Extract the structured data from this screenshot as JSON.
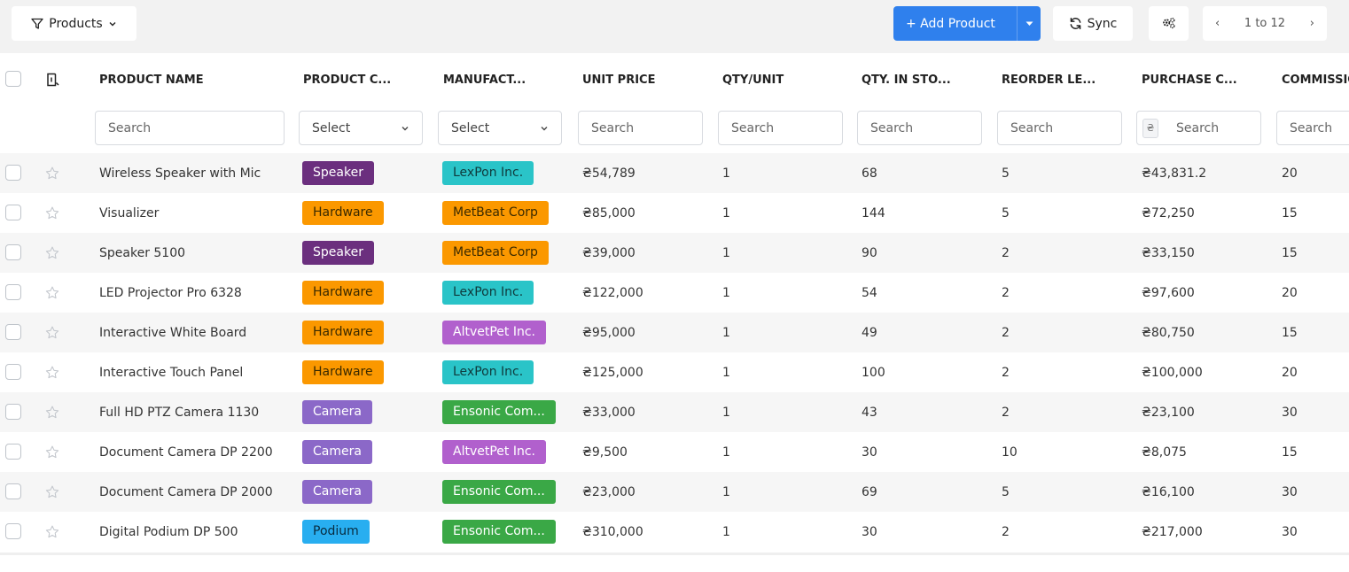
{
  "toolbar": {
    "products_label": "Products",
    "add_label": "+ Add Product",
    "sync_label": "Sync",
    "pager_label": "1 to 12"
  },
  "columns": [
    "PRODUCT NAME",
    "PRODUCT C...",
    "MANUFACT...",
    "UNIT PRICE",
    "QTY/UNIT",
    "QTY. IN STO...",
    "REORDER LE...",
    "PURCHASE C...",
    "COMMISSION"
  ],
  "filters": {
    "name": "Search",
    "category": "Select",
    "manufacturer": "Select",
    "unit_price": "Search",
    "qty_unit": "Search",
    "qty_stock": "Search",
    "reorder": "Search",
    "purchase_currency": "₴",
    "purchase": "Search",
    "commission": "Search"
  },
  "colors": {
    "accent": "#2f80ed",
    "Speaker": "#6b2f7e",
    "Hardware": "#fb9800",
    "Camera": "#8b68c8",
    "Podium": "#28aef0",
    "LexPon Inc.": "#2ac4c8",
    "MetBeat Corp": "#fb9800",
    "AltvetPet Inc.": "#b160cd",
    "Ensonic Com...": "#3aa846"
  },
  "rows": [
    {
      "name": "Wireless Speaker with Mic",
      "category": "Speaker",
      "manufacturer": "LexPon Inc.",
      "unit_price": "₴54,789",
      "qty_unit": "1",
      "qty_stock": "68",
      "reorder": "5",
      "purchase": "₴43,831.2",
      "commission": "20"
    },
    {
      "name": "Visualizer",
      "category": "Hardware",
      "manufacturer": "MetBeat Corp",
      "unit_price": "₴85,000",
      "qty_unit": "1",
      "qty_stock": "144",
      "reorder": "5",
      "purchase": "₴72,250",
      "commission": "15"
    },
    {
      "name": "Speaker 5100",
      "category": "Speaker",
      "manufacturer": "MetBeat Corp",
      "unit_price": "₴39,000",
      "qty_unit": "1",
      "qty_stock": "90",
      "reorder": "2",
      "purchase": "₴33,150",
      "commission": "15"
    },
    {
      "name": "LED Projector Pro 6328",
      "category": "Hardware",
      "manufacturer": "LexPon Inc.",
      "unit_price": "₴122,000",
      "qty_unit": "1",
      "qty_stock": "54",
      "reorder": "2",
      "purchase": "₴97,600",
      "commission": "20"
    },
    {
      "name": "Interactive White Board",
      "category": "Hardware",
      "manufacturer": "AltvetPet Inc.",
      "unit_price": "₴95,000",
      "qty_unit": "1",
      "qty_stock": "49",
      "reorder": "2",
      "purchase": "₴80,750",
      "commission": "15"
    },
    {
      "name": "Interactive Touch Panel",
      "category": "Hardware",
      "manufacturer": "LexPon Inc.",
      "unit_price": "₴125,000",
      "qty_unit": "1",
      "qty_stock": "100",
      "reorder": "2",
      "purchase": "₴100,000",
      "commission": "20"
    },
    {
      "name": "Full HD PTZ Camera 1130",
      "category": "Camera",
      "manufacturer": "Ensonic Com...",
      "unit_price": "₴33,000",
      "qty_unit": "1",
      "qty_stock": "43",
      "reorder": "2",
      "purchase": "₴23,100",
      "commission": "30"
    },
    {
      "name": "Document Camera DP 2200",
      "category": "Camera",
      "manufacturer": "AltvetPet Inc.",
      "unit_price": "₴9,500",
      "qty_unit": "1",
      "qty_stock": "30",
      "reorder": "10",
      "purchase": "₴8,075",
      "commission": "15"
    },
    {
      "name": "Document Camera DP 2000",
      "category": "Camera",
      "manufacturer": "Ensonic Com...",
      "unit_price": "₴23,000",
      "qty_unit": "1",
      "qty_stock": "69",
      "reorder": "5",
      "purchase": "₴16,100",
      "commission": "30"
    },
    {
      "name": "Digital Podium DP 500",
      "category": "Podium",
      "manufacturer": "Ensonic Com...",
      "unit_price": "₴310,000",
      "qty_unit": "1",
      "qty_stock": "30",
      "reorder": "2",
      "purchase": "₴217,000",
      "commission": "30"
    }
  ]
}
